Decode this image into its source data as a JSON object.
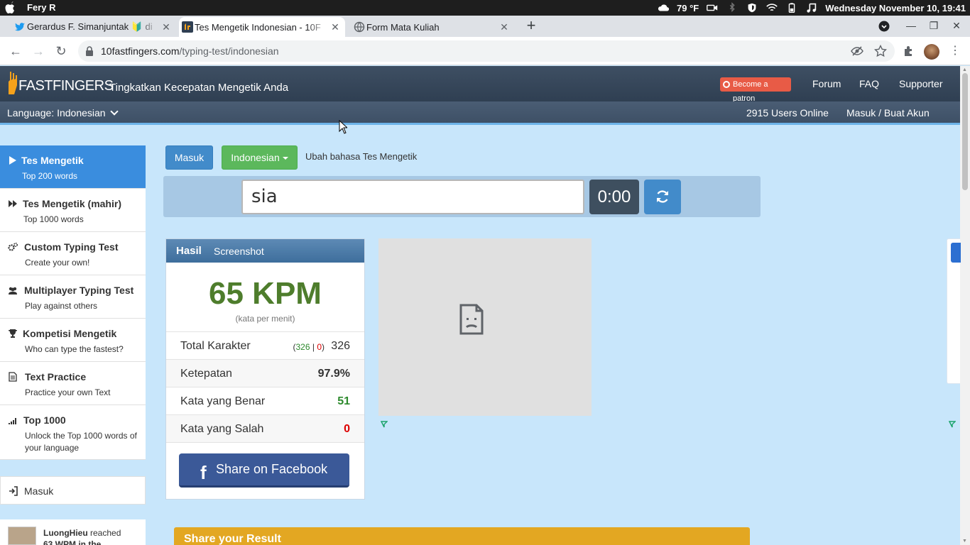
{
  "os": {
    "user": "Fery R",
    "temperature": "79 °F",
    "datetime": "Wednesday November 10, 19:41"
  },
  "browser": {
    "tabs": [
      {
        "title": "Gerardus F. Simanjuntak 🔰 di",
        "icon": "twitter-icon"
      },
      {
        "title": "Tes Mengetik Indonesian - 10F",
        "icon": "10fastfingers-favicon"
      },
      {
        "title": "Form Mata Kuliah",
        "icon": "globe-icon"
      }
    ],
    "url_host": "10fastfingers.com",
    "url_path": "/typing-test/indonesian"
  },
  "header": {
    "logo_num": "10",
    "logo_text": "FASTFINGERS",
    "tagline": "Tingkatkan Kecepatan Mengetik Anda",
    "patron": "Become a patron",
    "links": [
      "Forum",
      "FAQ",
      "Supporter"
    ],
    "language": "Language: Indonesian",
    "online": "2915 Users Online",
    "login": "Masuk / Buat Akun"
  },
  "sidebar": {
    "items": [
      {
        "title": "Tes Mengetik",
        "sub": "Top 200 words",
        "icon": "play-icon"
      },
      {
        "title": "Tes Mengetik (mahir)",
        "sub": "Top 1000 words",
        "icon": "fast-forward-icon"
      },
      {
        "title": "Custom Typing Test",
        "sub": "Create your own!",
        "icon": "gears-icon"
      },
      {
        "title": "Multiplayer Typing Test",
        "sub": "Play against others",
        "icon": "users-icon"
      },
      {
        "title": "Kompetisi Mengetik",
        "sub": "Who can type the fastest?",
        "icon": "trophy-icon"
      },
      {
        "title": "Text Practice",
        "sub": "Practice your own Text",
        "icon": "document-icon"
      },
      {
        "title": "Top 1000",
        "sub": "Unlock the Top 1000 words of your language",
        "icon": "signal-icon"
      }
    ],
    "login": "Masuk",
    "feed_user": "LuongHieu",
    "feed_text": "reached",
    "feed_more": "63 WPM in the"
  },
  "controls": {
    "masuk": "Masuk",
    "language": "Indonesian",
    "change_lang": "Ubah bahasa Tes Mengetik",
    "input_value": "sia",
    "timer": "0:00"
  },
  "results": {
    "tab_result": "Hasil",
    "tab_screenshot": "Screenshot",
    "wpm": "65 KPM",
    "wpm_sub": "(kata per menit)",
    "rows": [
      {
        "label": "Total Karakter",
        "value": "326",
        "correct": "326",
        "sep": "|",
        "wrong": "0"
      },
      {
        "label": "Ketepatan",
        "value": "97.9%"
      },
      {
        "label": "Kata yang Benar",
        "value": "51"
      },
      {
        "label": "Kata yang Salah",
        "value": "0"
      }
    ],
    "facebook": "Share on Facebook"
  },
  "share": {
    "title": "Share your Result"
  },
  "colors": {
    "accent_blue": "#3a8dde",
    "green_button": "#5cb85c",
    "wpm_green": "#4e7d2c",
    "facebook": "#3b5998",
    "share_gold": "#e3a722"
  }
}
